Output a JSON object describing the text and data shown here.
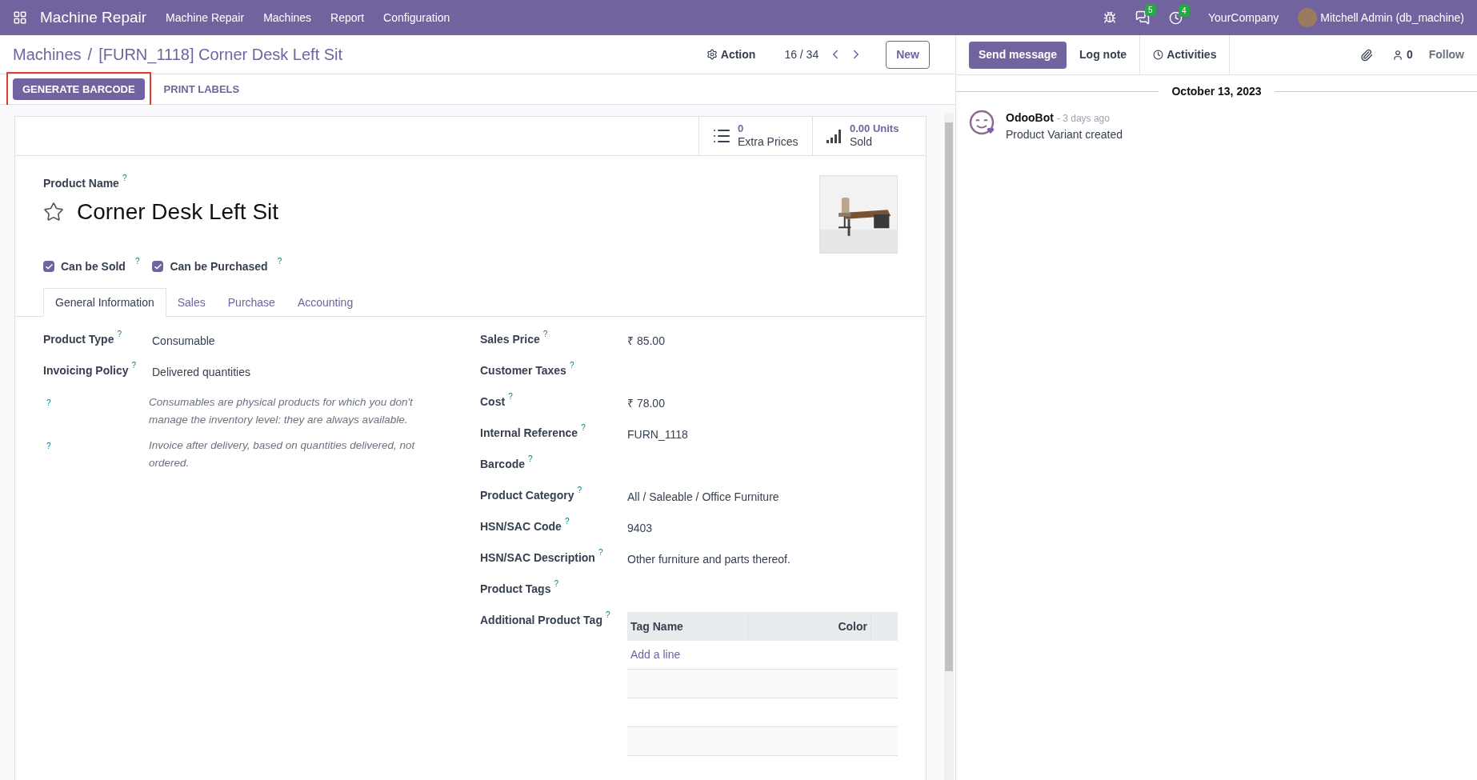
{
  "navbar": {
    "app_name": "Machine Repair",
    "menu": [
      "Machine Repair",
      "Machines",
      "Report",
      "Configuration"
    ],
    "messages_count": "5",
    "activities_count": "4",
    "company": "YourCompany",
    "user": "Mitchell Admin (db_machine)"
  },
  "breadcrumb": {
    "parent": "Machines",
    "separator": "/",
    "current": "[FURN_1118] Corner Desk Left Sit"
  },
  "control_panel": {
    "action": "Action",
    "pager": "16 / 34",
    "new_button": "New"
  },
  "header_buttons": [
    {
      "label": "GENERATE BARCODE",
      "kind": "primary",
      "highlighted": true
    },
    {
      "label": "PRINT LABELS",
      "kind": "secondary",
      "highlighted": false
    }
  ],
  "stat_buttons": [
    {
      "kind": "list",
      "value": "0",
      "label": "Extra Prices"
    },
    {
      "kind": "signal",
      "value": "0.00 Units",
      "label": "Sold"
    }
  ],
  "product": {
    "name_label": "Product Name",
    "help": "?",
    "name": "Corner Desk Left Sit",
    "favorite": false
  },
  "checkboxes": [
    {
      "label": "Can be Sold",
      "help": "?",
      "checked": true
    },
    {
      "label": "Can be Purchased",
      "help": "?",
      "checked": true
    }
  ],
  "tabs": [
    {
      "label": "General Information",
      "selected": true
    },
    {
      "label": "Sales",
      "selected": false
    },
    {
      "label": "Purchase",
      "selected": false
    },
    {
      "label": "Accounting",
      "selected": false
    }
  ],
  "left_fields": [
    {
      "label": "Product Type",
      "help": "?",
      "value": "Consumable"
    },
    {
      "label": "Invoicing Policy",
      "help": "?",
      "value": "Delivered quantities"
    }
  ],
  "notes": [
    {
      "help": "?",
      "text": "Consumables are physical products for which you don't manage the inventory level: they are always available."
    },
    {
      "help": "?",
      "text": "Invoice after delivery, based on quantities delivered, not ordered."
    }
  ],
  "right_fields": [
    {
      "label": "Sales Price",
      "help": "?",
      "value": "₹ 85.00"
    },
    {
      "label": "Customer Taxes",
      "help": "?"
    },
    {
      "label": "Cost",
      "help": "?",
      "value": "₹ 78.00"
    },
    {
      "label": "Internal Reference",
      "help": "?",
      "value": "FURN_1118"
    },
    {
      "label": "Barcode",
      "help": "?"
    },
    {
      "label": "Product Category",
      "help": "?",
      "value": "All / Saleable / Office Furniture"
    },
    {
      "label": "HSN/SAC Code",
      "help": "?",
      "value": "9403"
    },
    {
      "label": "HSN/SAC Description",
      "help": "?",
      "value": "Other furniture and parts thereof."
    },
    {
      "label": "Product Tags",
      "help": "?"
    }
  ],
  "tag_table": {
    "label": "Additional Product Tag",
    "help": "?",
    "columns": [
      "Tag Name",
      "Color"
    ],
    "add_line": "Add a line"
  },
  "chatter": {
    "send_message": "Send message",
    "log_note": "Log note",
    "activities": "Activities",
    "followers_count": "0",
    "follow": "Follow",
    "date": "October 13, 2023",
    "messages": [
      {
        "author": "OdooBot",
        "time": "- 3 days ago",
        "body": "Product Variant created"
      }
    ]
  }
}
